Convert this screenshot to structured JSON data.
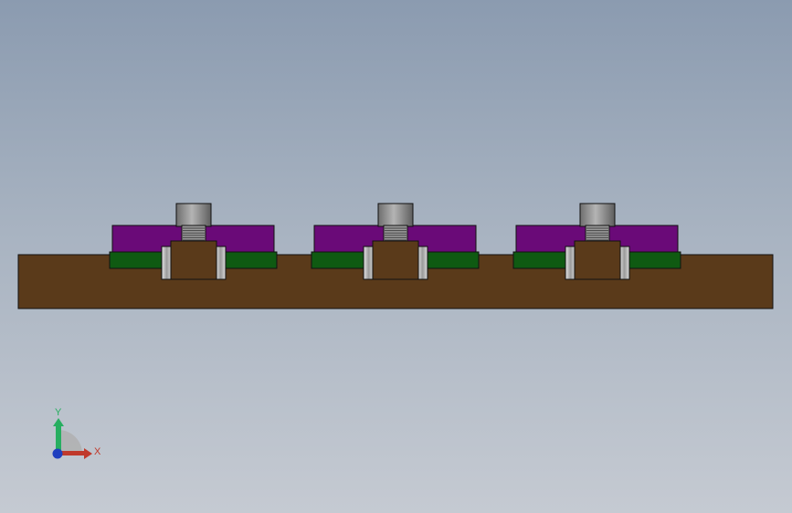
{
  "viewport": {
    "background_top": "#8b9bb0",
    "background_bottom": "#c5cad2"
  },
  "model": {
    "assembly_count": 3,
    "colors": {
      "base_plate": "#5a3a1a",
      "clamp_block": "#6a0a78",
      "rail_strip": "#0f5a12",
      "nut_block": "#5a3a1a",
      "screw_cap": "#8c8c8c",
      "washer": "#bdbdbd",
      "edge": "#111111"
    }
  },
  "triad": {
    "x_label": "X",
    "y_label": "Y",
    "x_color": "#c0392b",
    "y_color": "#27ae60",
    "z_color": "#1f3fbf"
  }
}
